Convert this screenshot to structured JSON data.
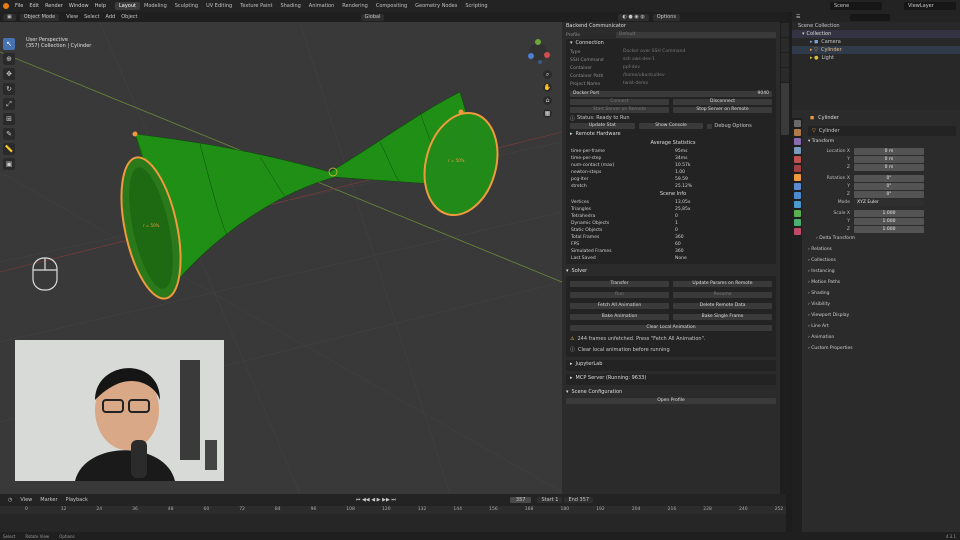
{
  "menu": [
    "File",
    "Edit",
    "Render",
    "Window",
    "Help"
  ],
  "workspaces": [
    "Layout",
    "Modeling",
    "Sculpting",
    "UV Editing",
    "Texture Paint",
    "Shading",
    "Animation",
    "Rendering",
    "Compositing",
    "Geometry Nodes",
    "Scripting"
  ],
  "active_workspace": "Layout",
  "scene_name": "Scene",
  "view_layer": "ViewLayer",
  "viewport_header": {
    "mode": "Object Mode",
    "menus": [
      "View",
      "Select",
      "Add",
      "Object"
    ],
    "orientation": "Global",
    "options": "Options"
  },
  "viewport_info": {
    "line1": "User Perspective",
    "line2": "(357) Collection | Cylinder"
  },
  "npanel": {
    "title": "Backend Communicator",
    "profile_label": "Profile",
    "profile_value": "Default",
    "connection_title": "Connection",
    "fields": [
      {
        "label": "Type",
        "value": "Docker over SSH Command"
      },
      {
        "label": "SSH Command",
        "value": "ssh aws-dev-1"
      },
      {
        "label": "Container",
        "value": "ppf-dev"
      },
      {
        "label": "Container Path",
        "value": "/home/ubuntu/dev"
      },
      {
        "label": "Project Name",
        "value": "twist-demo"
      }
    ],
    "docker_port_label": "Docker Port",
    "docker_port_value": "9040",
    "connect": "Connect",
    "disconnect": "Disconnect",
    "start_server": "Start Server on Remote",
    "stop_server": "Stop Server on Remote",
    "status": "Status: Ready to Run",
    "update_stat": "Update Stat",
    "show_console": "Show Console",
    "debug_options": "Debug Options",
    "remote_hardware": "Remote Hardware",
    "avg_stats_title": "Average Statistics",
    "avg_stats": [
      {
        "k": "time-per-frame",
        "v": "95ms"
      },
      {
        "k": "time-per-step",
        "v": "34ms"
      },
      {
        "k": "num-contact (max)",
        "v": "10.57k"
      },
      {
        "k": "newton-steps",
        "v": "1.00"
      },
      {
        "k": "pcg-iter",
        "v": "59.59"
      },
      {
        "k": "stretch",
        "v": "25.12%"
      }
    ],
    "scene_info_title": "Scene Info",
    "scene_info": [
      {
        "k": "Vertices",
        "v": "13,05x"
      },
      {
        "k": "Triangles",
        "v": "25,85x"
      },
      {
        "k": "Tetrahedra",
        "v": "0"
      },
      {
        "k": "Dynamic Objects",
        "v": "1"
      },
      {
        "k": "Static Objects",
        "v": "0"
      },
      {
        "k": "Total Frames",
        "v": "360"
      },
      {
        "k": "FPS",
        "v": "60"
      },
      {
        "k": "Simulated Frames",
        "v": "360"
      },
      {
        "k": "Last Saved",
        "v": "None"
      }
    ],
    "solver_title": "Solver",
    "transfer": "Transfer",
    "update_params": "Update Params on Remote",
    "run": "Run",
    "resume": "Resume",
    "fetch_all": "Fetch All Animation",
    "delete_remote": "Delete Remote Data",
    "bake_animation": "Bake Animation",
    "bake_single": "Bake Single Frame",
    "clear_local": "Clear Local Animation",
    "warn1": "244 frames unfetched. Press \"Fetch All Animation\".",
    "warn2": "Clear local animation before running",
    "jupyterlab": "JupyterLab",
    "mcp_server": "MCP Server (Running: 9633)",
    "scene_config": "Scene Configuration",
    "open_profile": "Open Profile"
  },
  "outliner": {
    "title": "Scene Collection",
    "items": [
      {
        "name": "Collection",
        "indent": 0
      },
      {
        "name": "Camera",
        "indent": 1
      },
      {
        "name": "Cylinder",
        "indent": 1
      },
      {
        "name": "Light",
        "indent": 1
      }
    ]
  },
  "properties": {
    "object_name": "Cylinder",
    "data_name": "Cylinder",
    "transform": "Transform",
    "location": {
      "label": "Location X",
      "x": "0 m",
      "y": "0 m",
      "z": "0 m"
    },
    "rotation": {
      "label": "Rotation X",
      "x": "0°",
      "y": "0°",
      "z": "0°"
    },
    "mode_label": "Mode",
    "mode_value": "XYZ Euler",
    "scale": {
      "label": "Scale X",
      "x": "1.000",
      "y": "1.000",
      "z": "1.000"
    },
    "y_label": "Y",
    "z_label": "Z",
    "sections": [
      "Delta Transform",
      "Relations",
      "Collections",
      "Instancing",
      "Motion Paths",
      "Shading",
      "Visibility",
      "Viewport Display",
      "Line Art",
      "Animation",
      "Custom Properties"
    ]
  },
  "timeline": {
    "menus": [
      "View",
      "Marker",
      "Playback"
    ],
    "current_frame": "357",
    "start_label": "Start",
    "start": "1",
    "end_label": "End",
    "end": "357",
    "ticks": [
      "0",
      "12",
      "24",
      "36",
      "48",
      "60",
      "72",
      "84",
      "96",
      "108",
      "120",
      "132",
      "144",
      "156",
      "168",
      "180",
      "192",
      "204",
      "216",
      "228",
      "240",
      "252"
    ]
  },
  "statusbar": {
    "items": [
      "Select",
      "Rotate View",
      "Options"
    ],
    "version": "4.3.1"
  },
  "mesh_labels": {
    "left": "r = 50%",
    "right": "r = 50%"
  }
}
